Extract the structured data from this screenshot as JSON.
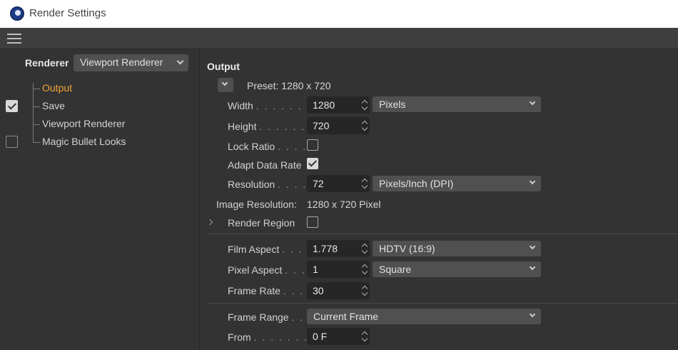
{
  "window": {
    "title": "Render Settings"
  },
  "sidebar": {
    "renderer_label": "Renderer",
    "renderer_value": "Viewport Renderer",
    "items": [
      {
        "label": "Output",
        "active": true,
        "checkbox": null
      },
      {
        "label": "Save",
        "active": false,
        "checkbox": true
      },
      {
        "label": "Viewport Renderer",
        "active": false,
        "checkbox": null
      },
      {
        "label": "Magic Bullet Looks",
        "active": false,
        "checkbox": false
      }
    ]
  },
  "output": {
    "title": "Output",
    "preset": "Preset: 1280 x 720",
    "width": {
      "label": "Width",
      "dots": ". . . . . . .",
      "value": "1280",
      "unit": "Pixels"
    },
    "height": {
      "label": "Height",
      "dots": ". . . . . .",
      "value": "720"
    },
    "lock_ratio": {
      "label": "Lock Ratio",
      "dots": ". . . .",
      "checked": false
    },
    "adapt_data_rate": {
      "label": "Adapt Data Rate",
      "checked": true
    },
    "resolution": {
      "label": "Resolution",
      "dots": ". . . .",
      "value": "72",
      "unit": "Pixels/Inch (DPI)"
    },
    "image_resolution": {
      "label": "Image Resolution:",
      "value": "1280 x 720 Pixel"
    },
    "render_region": {
      "label": "Render Region",
      "checked": false
    },
    "film_aspect": {
      "label": "Film Aspect",
      "dots": ". . .",
      "value": "1.778",
      "preset": "HDTV (16:9)"
    },
    "pixel_aspect": {
      "label": "Pixel Aspect",
      "dots": ". . .",
      "value": "1",
      "preset": "Square"
    },
    "frame_rate": {
      "label": "Frame Rate",
      "dots": ". . .",
      "value": "30"
    },
    "frame_range": {
      "label": "Frame Range",
      "dots": ". .",
      "value": "Current Frame"
    },
    "from": {
      "label": "From",
      "dots": ". . . . . . .",
      "value": "0 F"
    }
  }
}
